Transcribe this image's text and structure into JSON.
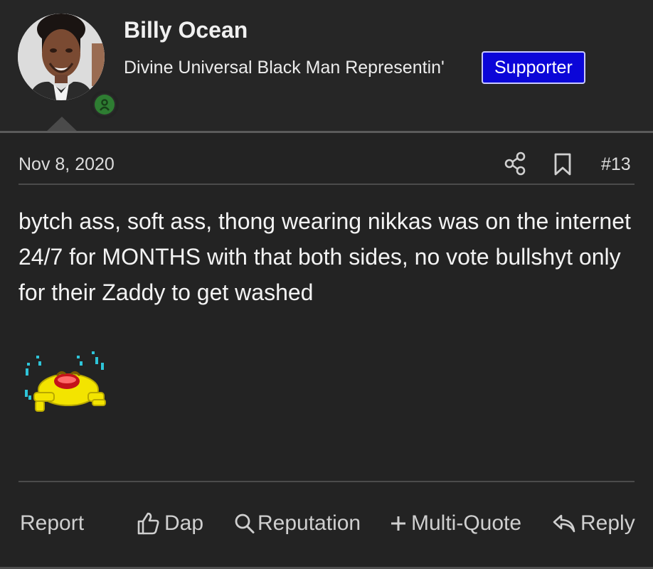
{
  "user": {
    "name": "Billy Ocean",
    "title": "Divine Universal Black Man Representin'",
    "badge": "Supporter",
    "online": true
  },
  "post": {
    "date": "Nov 8, 2020",
    "number": "#13",
    "body": "bytch ass, soft ass, thong wearing nikkas was on the internet 24/7 for MONTHS with that both sides, no vote bullshyt only for their Zaddy to get washed",
    "emoji": "crying-laughing-smiley"
  },
  "actions": {
    "report": "Report",
    "dap": "Dap",
    "reputation": "Reputation",
    "multi_quote": "Multi-Quote",
    "reply": "Reply"
  },
  "icons": {
    "share": "share-icon",
    "bookmark": "bookmark-icon",
    "thumbs_up": "thumbs-up-icon",
    "search": "search-icon",
    "plus": "plus-icon",
    "reply": "reply-arrow-icon",
    "online": "user-online-icon"
  },
  "colors": {
    "background": "#232323",
    "badge_background": "#0b06d8",
    "badge_border": "#c9c9ff",
    "online_status": "#2e7d32",
    "text": "#ececec"
  }
}
